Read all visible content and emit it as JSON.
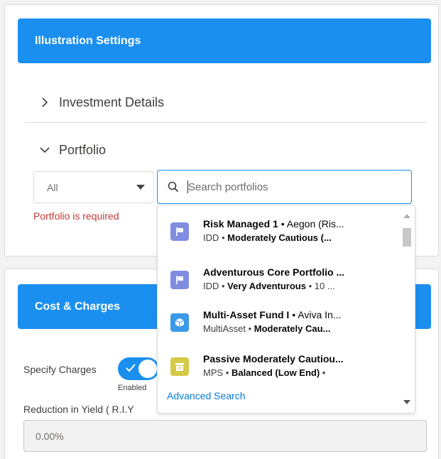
{
  "illustration": {
    "title": "Illustration Settings",
    "sections": [
      {
        "label": "Investment Details",
        "expanded": false
      },
      {
        "label": "Portfolio",
        "expanded": true
      }
    ],
    "filter": {
      "value": "All"
    },
    "search": {
      "placeholder": "Search portfolios"
    },
    "error": "Portfolio is required"
  },
  "results": [
    {
      "icon": "flag-icon",
      "color": "#7f8de1",
      "name": "Risk Managed 1",
      "provider": "Aegon (Ris...",
      "type": "IDD",
      "risk": "Moderately Cautious (...",
      "extra": ""
    },
    {
      "icon": "flag-icon",
      "color": "#7f8de1",
      "name": "Adventurous Core Portfolio ...",
      "provider": "",
      "type": "IDD",
      "risk": "Very Adventurous",
      "extra": "10 ..."
    },
    {
      "icon": "cube-icon",
      "color": "#3b9ae8",
      "name": "Multi-Asset Fund I",
      "provider": "Aviva In...",
      "type": "MultiAsset",
      "risk": "Moderately Cau...",
      "extra": ""
    },
    {
      "icon": "archive-icon",
      "color": "#d4c948",
      "name": "Passive Moderately Cautiou...",
      "provider": "",
      "type": "MPS",
      "risk": "Balanced (Low End)",
      "extra": ""
    }
  ],
  "advanced_search": "Advanced Search",
  "costs": {
    "title": "Cost & Charges",
    "specify_label": "Specify Charges",
    "toggle_state": "Enabled",
    "riy_label": "Reduction in Yield ( R.I.Y",
    "riy_value": "0.00%"
  }
}
